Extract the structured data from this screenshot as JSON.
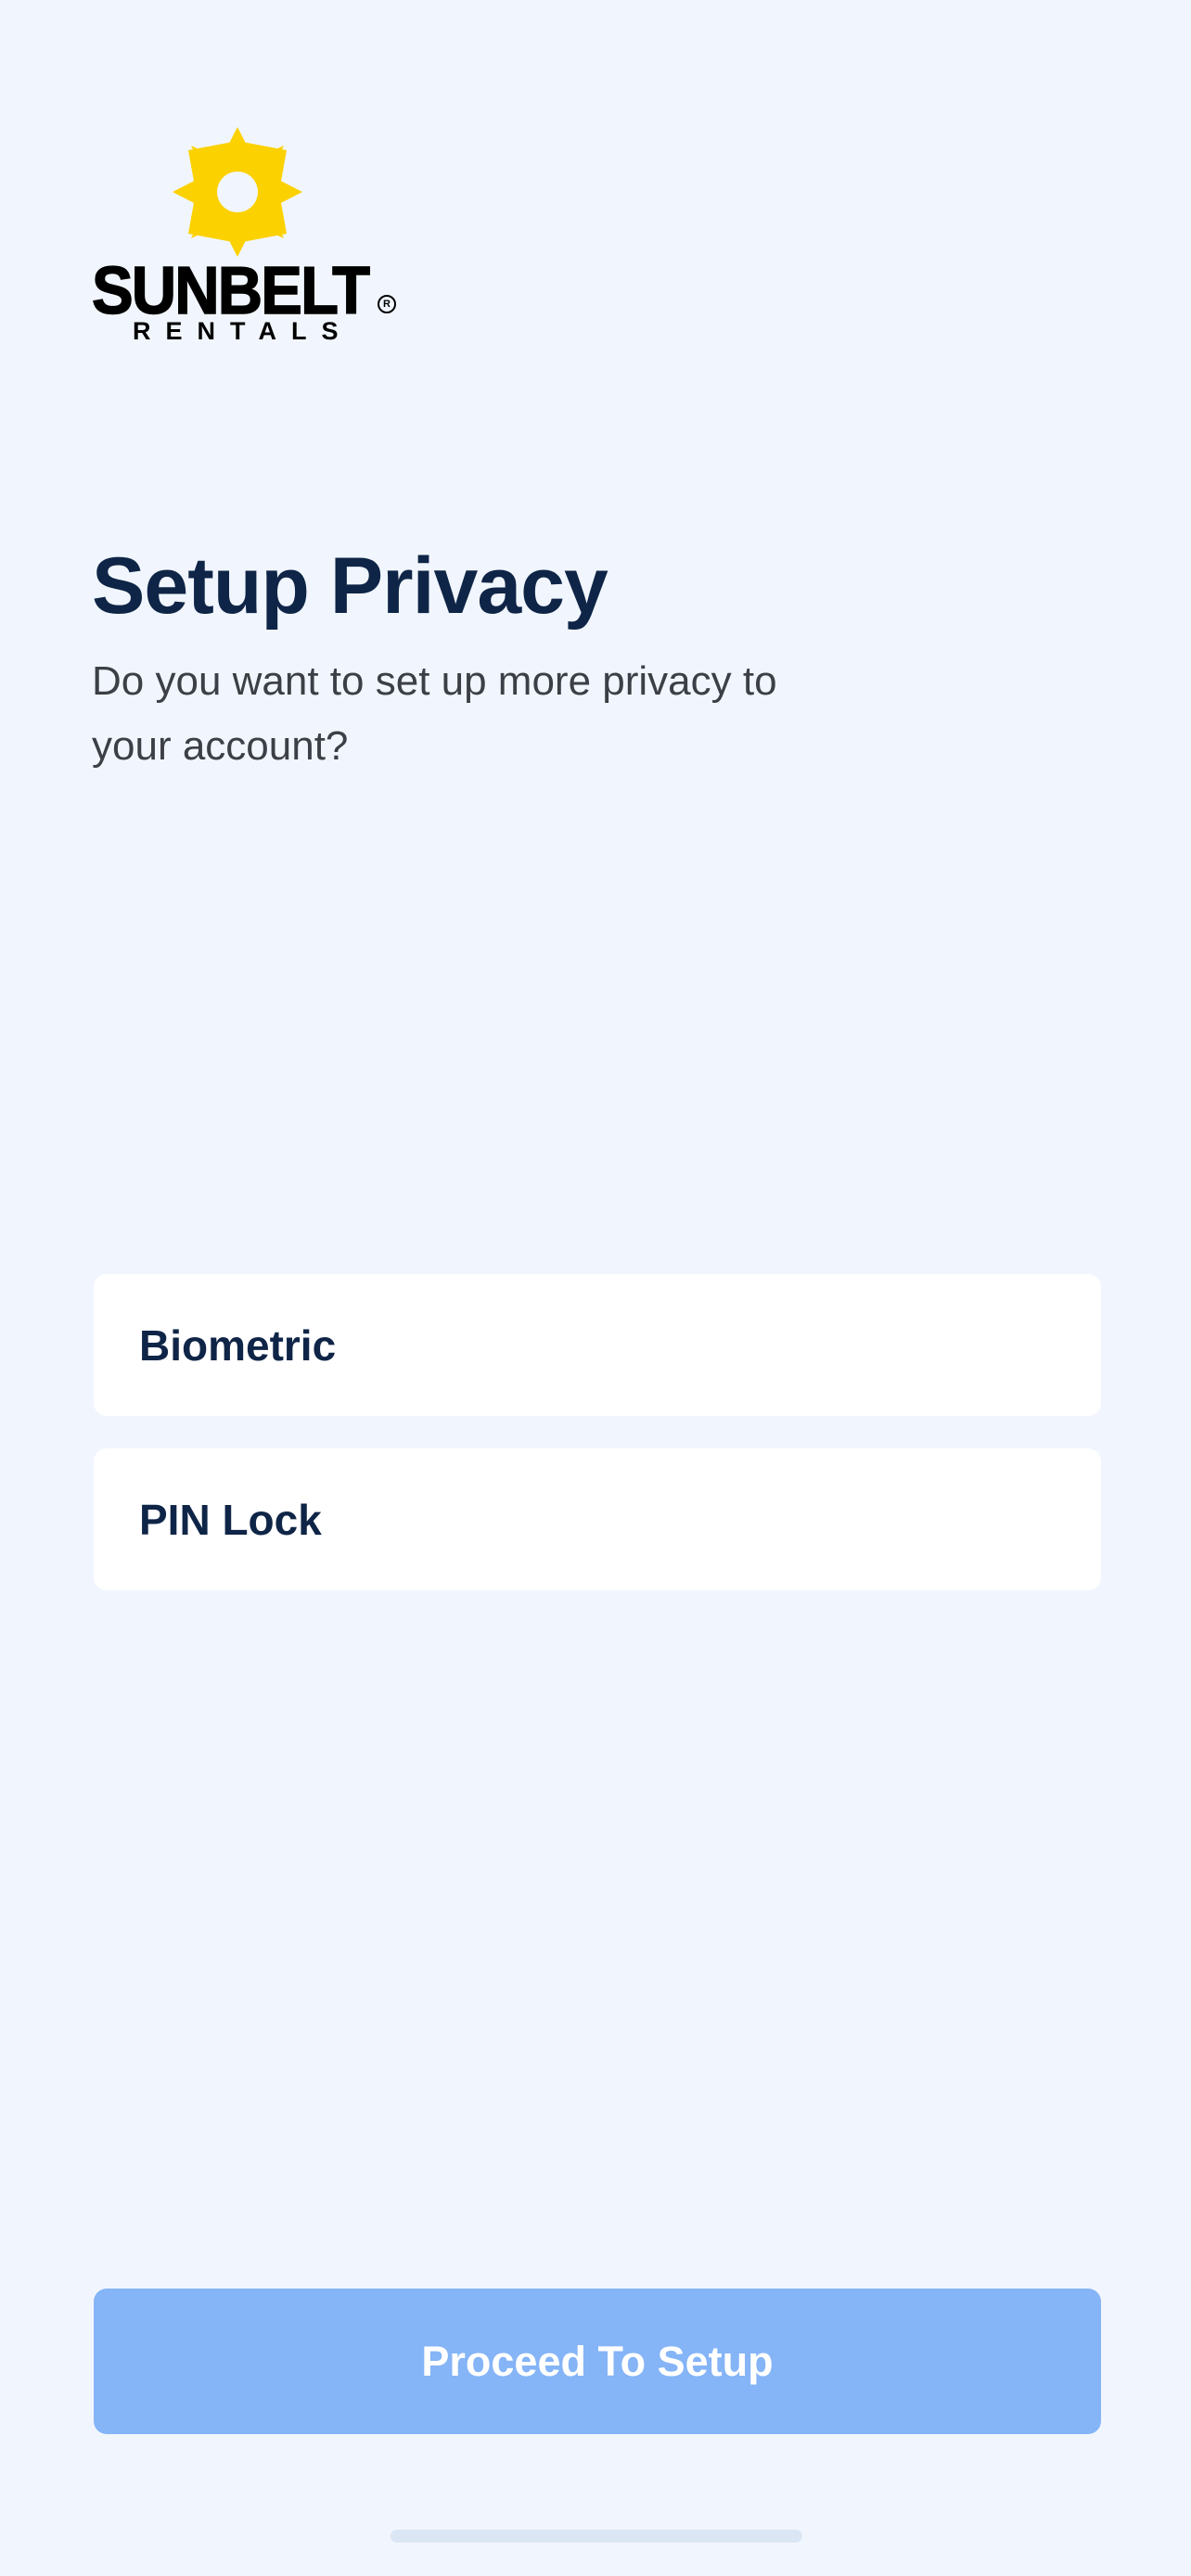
{
  "brand": {
    "name": "SUNBELT",
    "sub": "RENTALS",
    "registered": "R",
    "logo_icon": "sun-logo-icon",
    "logo_color": "#fcd100"
  },
  "header": {
    "title": "Setup Privacy",
    "subtitle": "Do you want to set up more privacy to your account?"
  },
  "options": [
    {
      "label": "Biometric"
    },
    {
      "label": "PIN Lock"
    }
  ],
  "actions": {
    "proceed_label": "Proceed To Setup"
  },
  "colors": {
    "background": "#f1f6fe",
    "title": "#0f2547",
    "button": "#85b4f7",
    "card": "#ffffff"
  }
}
